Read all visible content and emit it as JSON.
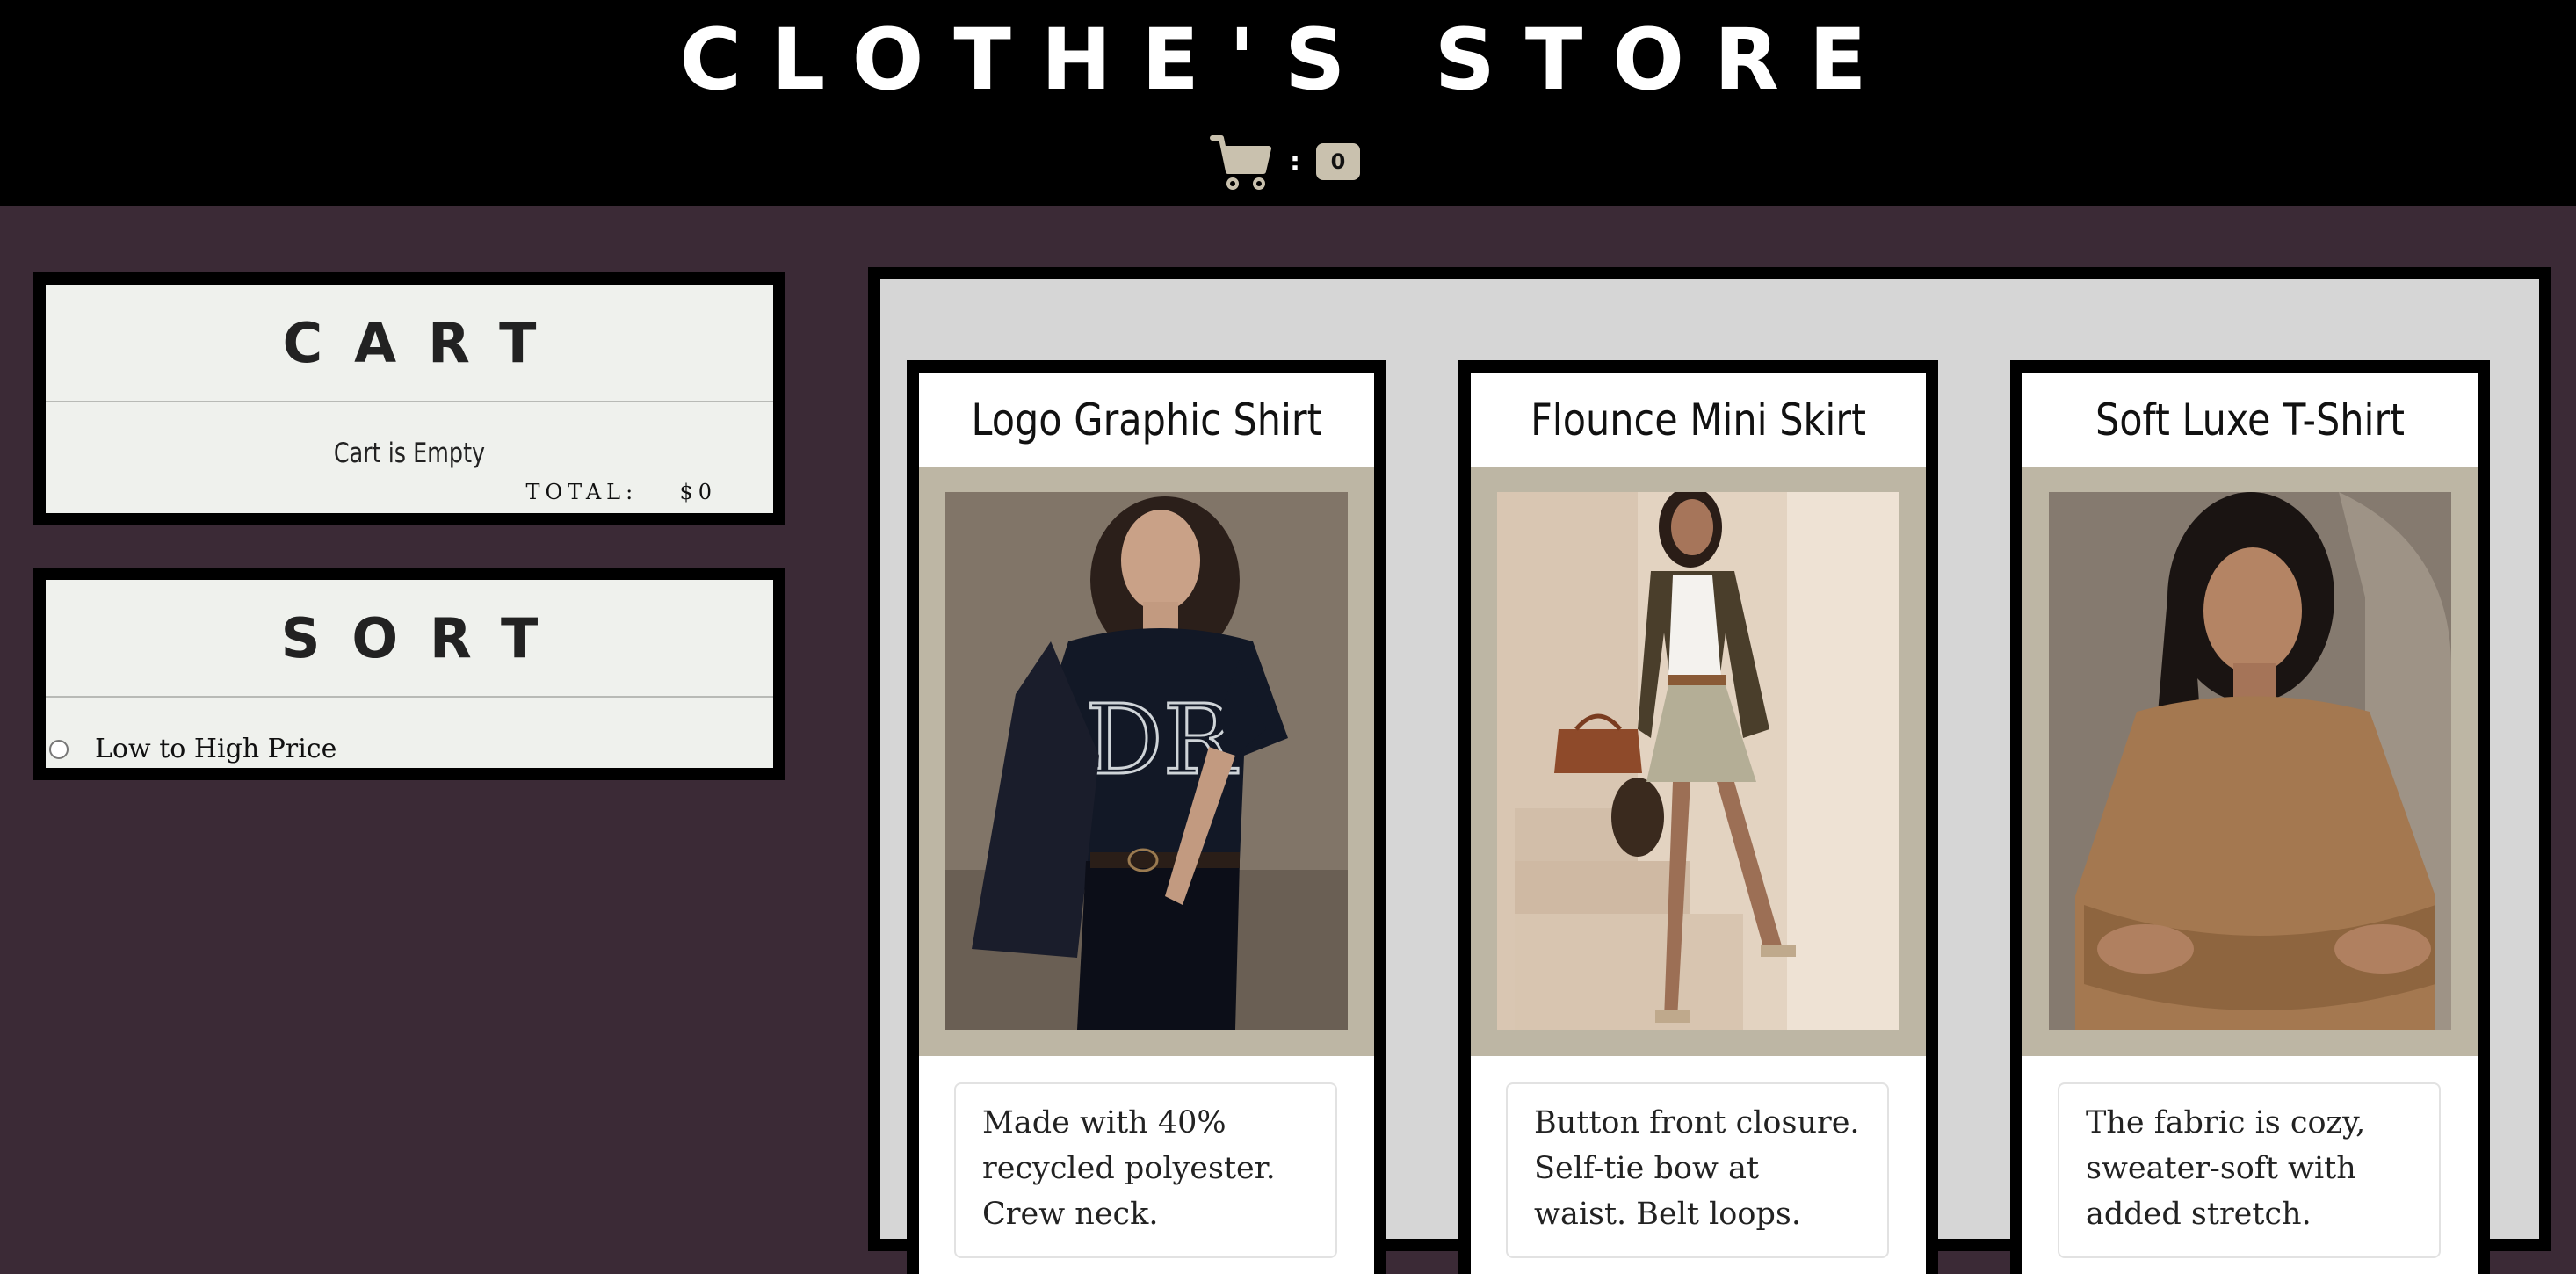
{
  "header": {
    "title": "CLOTHE'S STORE",
    "cart_colon": ":",
    "cart_count": "0",
    "cart_icon": "cart-icon"
  },
  "cart_panel": {
    "title": "CART",
    "empty_text": "Cart is Empty",
    "total_label": "TOTAL:",
    "total_value": "$0"
  },
  "sort_panel": {
    "title": "SORT",
    "option_label": "Low to High Price",
    "option_selected": false
  },
  "products": [
    {
      "title": "Logo Graphic Shirt",
      "description": "Made with 40% recycled polyester. Crew neck."
    },
    {
      "title": "Flounce Mini Skirt",
      "description": "Button front closure. Self-tie bow at waist. Belt loops."
    },
    {
      "title": "Soft Luxe T-Shirt",
      "description": "The fabric is cozy, sweater-soft with added stretch."
    }
  ],
  "colors": {
    "page_bg": "#3b2a36",
    "header_bg": "#000000",
    "panel_bg": "#eff1ed",
    "product_area_bg": "#d6d6d6",
    "photo_mat": "#bdb6a4",
    "badge_bg": "#c9c1ae"
  }
}
